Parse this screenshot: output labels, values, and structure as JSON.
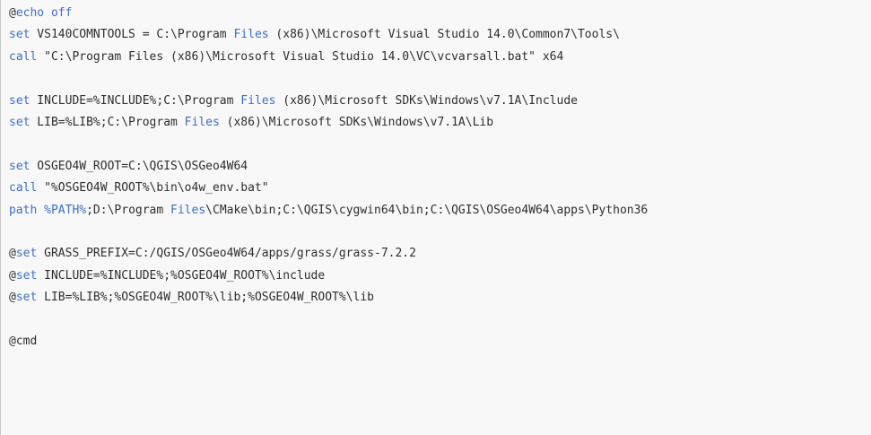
{
  "colors": {
    "background": "#f8f8f8",
    "text": "#2e2e2e",
    "keyword": "#3d6fc4",
    "border": "#c8c8c8"
  },
  "lines": [
    [
      {
        "t": "@",
        "k": 0
      },
      {
        "t": "echo off",
        "k": 1
      }
    ],
    [
      {
        "t": "set",
        "k": 1
      },
      {
        "t": " VS140COMNTOOLS = C:\\Program ",
        "k": 0
      },
      {
        "t": "Files",
        "k": 1
      },
      {
        "t": " (x86)\\Microsoft Visual Studio 14.0\\Common7\\Tools\\",
        "k": 0
      }
    ],
    [
      {
        "t": "call",
        "k": 1
      },
      {
        "t": " \"C:\\Program Files (x86)\\Microsoft Visual Studio 14.0\\VC\\vcvarsall.bat\" x64",
        "k": 0
      }
    ],
    [],
    [
      {
        "t": "set",
        "k": 1
      },
      {
        "t": " INCLUDE=%INCLUDE%;C:\\Program ",
        "k": 0
      },
      {
        "t": "Files",
        "k": 1
      },
      {
        "t": " (x86)\\Microsoft SDKs\\Windows\\v7.1A\\Include",
        "k": 0
      }
    ],
    [
      {
        "t": "set",
        "k": 1
      },
      {
        "t": " LIB=%LIB%;C:\\Program ",
        "k": 0
      },
      {
        "t": "Files",
        "k": 1
      },
      {
        "t": " (x86)\\Microsoft SDKs\\Windows\\v7.1A\\Lib",
        "k": 0
      }
    ],
    [],
    [
      {
        "t": "set",
        "k": 1
      },
      {
        "t": " OSGEO4W_ROOT=C:\\QGIS\\OSGeo4W64",
        "k": 0
      }
    ],
    [
      {
        "t": "call",
        "k": 1
      },
      {
        "t": " \"%OSGEO4W_ROOT%\\bin\\o4w_env.bat\"",
        "k": 0
      }
    ],
    [
      {
        "t": "path",
        "k": 1
      },
      {
        "t": " ",
        "k": 0
      },
      {
        "t": "%PATH%",
        "k": 1
      },
      {
        "t": ";D:\\Program ",
        "k": 0
      },
      {
        "t": "Files",
        "k": 1
      },
      {
        "t": "\\CMake\\bin;C:\\QGIS\\cygwin64\\bin;C:\\QGIS\\OSGeo4W64\\apps\\Python36",
        "k": 0
      }
    ],
    [],
    [
      {
        "t": "@",
        "k": 0
      },
      {
        "t": "set",
        "k": 1
      },
      {
        "t": " GRASS_PREFIX=C:/QGIS/OSGeo4W64/apps/grass/grass-7.2.2",
        "k": 0
      }
    ],
    [
      {
        "t": "@",
        "k": 0
      },
      {
        "t": "set",
        "k": 1
      },
      {
        "t": " INCLUDE=%INCLUDE%;%OSGEO4W_ROOT%\\include",
        "k": 0
      }
    ],
    [
      {
        "t": "@",
        "k": 0
      },
      {
        "t": "set",
        "k": 1
      },
      {
        "t": " LIB=%LIB%;%OSGEO4W_ROOT%\\lib;%OSGEO4W_ROOT%\\lib",
        "k": 0
      }
    ],
    [],
    [
      {
        "t": "@cmd",
        "k": 0
      }
    ]
  ]
}
